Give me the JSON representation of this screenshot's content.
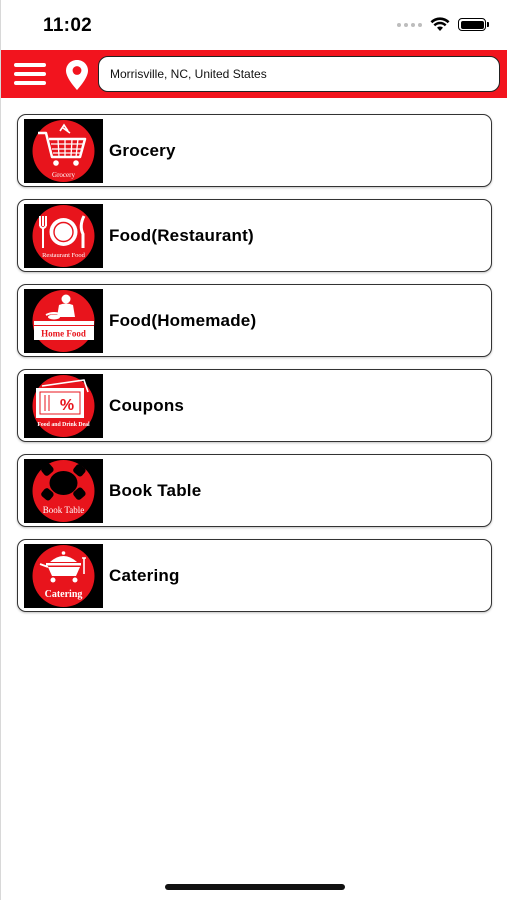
{
  "status_bar": {
    "time": "11:02"
  },
  "header": {
    "menu_icon": "hamburger-menu-icon",
    "location_icon": "location-pin-icon",
    "location_value": "Morrisville, NC, United States",
    "brand_color": "#f2141e"
  },
  "categories": [
    {
      "label": "Grocery",
      "icon": "grocery-cart-icon",
      "icon_caption": "Grocery"
    },
    {
      "label": "Food(Restaurant)",
      "icon": "restaurant-plate-icon",
      "icon_caption": "Restaurant Food"
    },
    {
      "label": "Food(Homemade)",
      "icon": "home-food-icon",
      "icon_caption": "Home Food"
    },
    {
      "label": "Coupons",
      "icon": "coupon-percent-icon",
      "icon_caption": "Food and Drink Deal"
    },
    {
      "label": "Book Table",
      "icon": "book-table-icon",
      "icon_caption": "Book Table"
    },
    {
      "label": "Catering",
      "icon": "catering-cart-icon",
      "icon_caption": "Catering"
    }
  ]
}
